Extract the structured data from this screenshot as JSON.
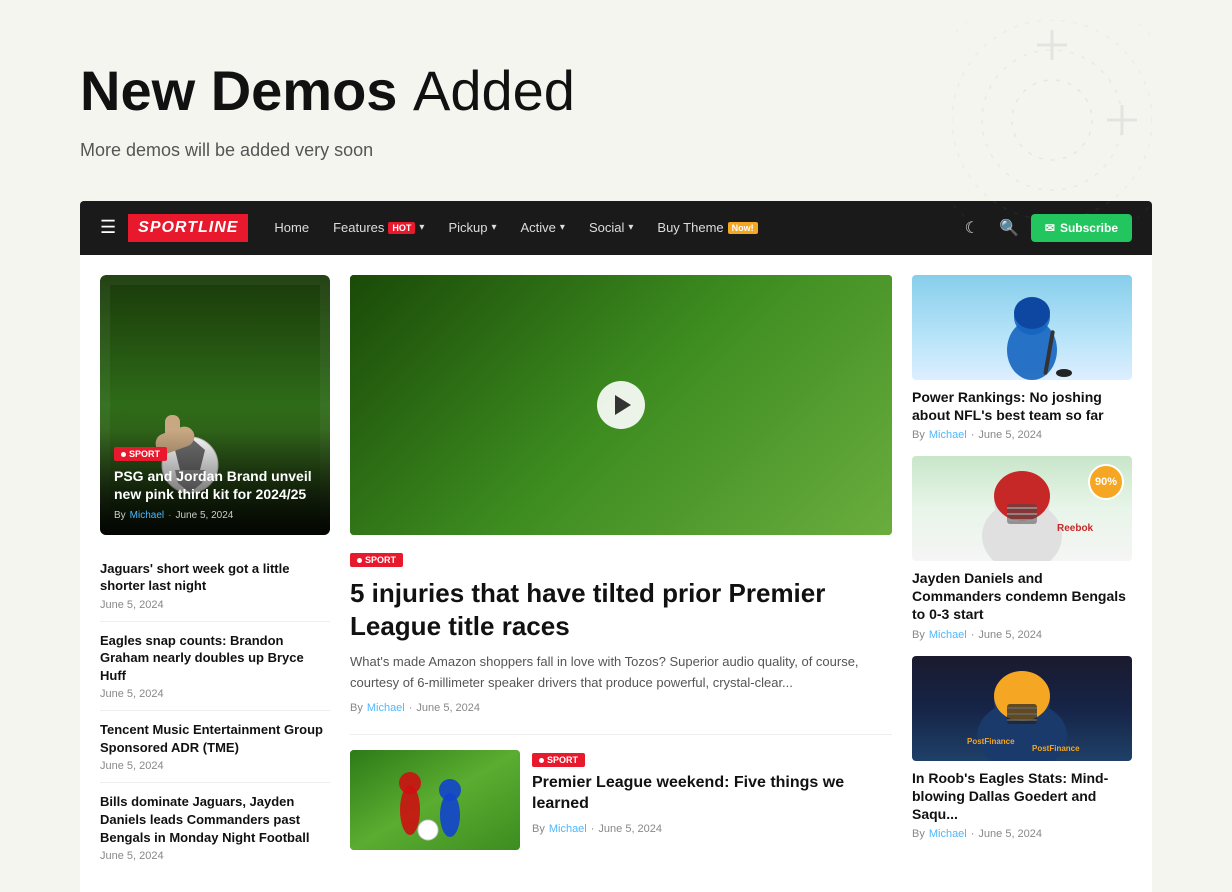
{
  "hero": {
    "title_bold": "New Demos",
    "title_light": "Added",
    "subtitle": "More demos will be added very soon"
  },
  "navbar": {
    "logo": "SPORTLINE",
    "items": [
      {
        "label": "Home",
        "badge": null,
        "has_dropdown": false
      },
      {
        "label": "Features",
        "badge": "Hot",
        "has_dropdown": true
      },
      {
        "label": "Pickup",
        "badge": null,
        "has_dropdown": true
      },
      {
        "label": "Active",
        "badge": null,
        "has_dropdown": true
      },
      {
        "label": "Social",
        "badge": null,
        "has_dropdown": true
      },
      {
        "label": "Buy Theme",
        "badge": "Now!",
        "has_dropdown": false
      }
    ],
    "subscribe_label": "Subscribe"
  },
  "featured_card": {
    "badge": "SPORT",
    "title": "PSG and Jordan Brand unveil new pink third kit for 2024/25",
    "author": "Michael",
    "date": "June 5, 2024"
  },
  "news_list": [
    {
      "title": "Jaguars' short week got a little shorter last night",
      "date": "June 5, 2024"
    },
    {
      "title": "Eagles snap counts: Brandon Graham nearly doubles up Bryce Huff",
      "date": "June 5, 2024"
    },
    {
      "title": "Tencent Music Entertainment Group Sponsored ADR (TME)",
      "date": "June 5, 2024"
    },
    {
      "title": "Bills dominate Jaguars, Jayden Daniels leads Commanders past Bengals in Monday Night Football",
      "date": "June 5, 2024"
    }
  ],
  "main_article": {
    "badge": "SPORT",
    "title": "5 injuries that have tilted prior Premier League title races",
    "excerpt": "What's made Amazon shoppers fall in love with Tozos? Superior audio quality, of course, courtesy of 6-millimeter speaker drivers that produce powerful, crystal-clear...",
    "author": "Michael",
    "date": "June 5, 2024"
  },
  "second_article": {
    "badge": "SPORT",
    "title": "Premier League weekend: Five things we learned",
    "author": "Michael",
    "date": "June 5, 2024"
  },
  "right_cards": [
    {
      "title": "Power Rankings: No joshing about NFL's best team so far",
      "author": "Michael",
      "date": "June 5, 2024",
      "score": null
    },
    {
      "title": "Jayden Daniels and Commanders condemn Bengals to 0-3 start",
      "author": "Michael",
      "date": "June 5, 2024",
      "score": "90%"
    },
    {
      "title": "In Roob's Eagles Stats: Mind-blowing Dallas Goedert and Saqu...",
      "author": "Michael",
      "date": "June 5, 2024",
      "score": null
    }
  ]
}
